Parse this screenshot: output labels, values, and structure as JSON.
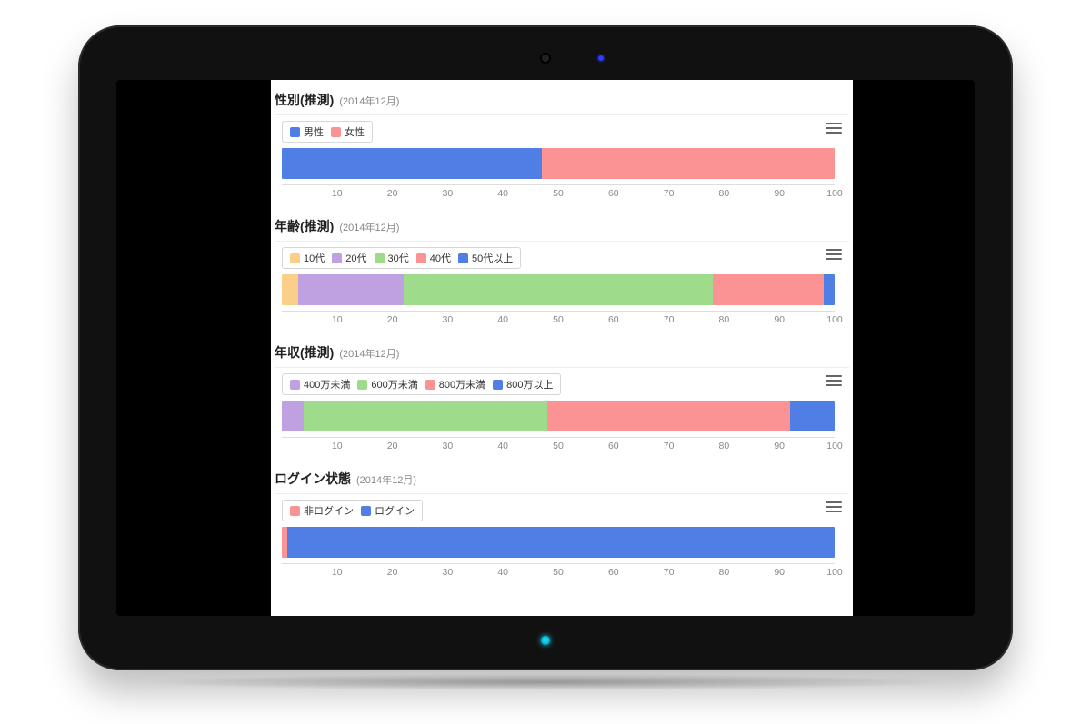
{
  "date_label": "(2014年12月)",
  "axis_ticks": [
    10,
    20,
    30,
    40,
    50,
    60,
    70,
    80,
    90,
    100
  ],
  "colors": {
    "blue": "#4f7ee5",
    "pink": "#fb9394",
    "orange": "#fbce8a",
    "purple": "#bfa0e0",
    "green": "#9edc8b"
  },
  "charts": [
    {
      "id": "gender",
      "title": "性別(推測)",
      "series": [
        {
          "name": "男性",
          "color": "blue",
          "value": 47
        },
        {
          "name": "女性",
          "color": "pink",
          "value": 53
        }
      ]
    },
    {
      "id": "age",
      "title": "年齢(推測)",
      "series": [
        {
          "name": "10代",
          "color": "orange",
          "value": 3
        },
        {
          "name": "20代",
          "color": "purple",
          "value": 19
        },
        {
          "name": "30代",
          "color": "green",
          "value": 56
        },
        {
          "name": "40代",
          "color": "pink",
          "value": 20
        },
        {
          "name": "50代以上",
          "color": "blue",
          "value": 2
        }
      ]
    },
    {
      "id": "income",
      "title": "年収(推測)",
      "series": [
        {
          "name": "400万未満",
          "color": "purple",
          "value": 4
        },
        {
          "name": "600万未満",
          "color": "green",
          "value": 44
        },
        {
          "name": "800万未満",
          "color": "pink",
          "value": 44
        },
        {
          "name": "800万以上",
          "color": "blue",
          "value": 8
        }
      ]
    },
    {
      "id": "login",
      "title": "ログイン状態",
      "series": [
        {
          "name": "非ログイン",
          "color": "pink",
          "value": 1
        },
        {
          "name": "ログイン",
          "color": "blue",
          "value": 99
        }
      ]
    }
  ],
  "chart_data": [
    {
      "type": "bar",
      "title": "性別(推測) (2014年12月)",
      "orientation": "horizontal-stacked-100",
      "xlabel": "",
      "ylabel": "",
      "xlim": [
        0,
        100
      ],
      "categories": [
        ""
      ],
      "series": [
        {
          "name": "男性",
          "values": [
            47
          ]
        },
        {
          "name": "女性",
          "values": [
            53
          ]
        }
      ],
      "x_ticks": [
        10,
        20,
        30,
        40,
        50,
        60,
        70,
        80,
        90,
        100
      ]
    },
    {
      "type": "bar",
      "title": "年齢(推測) (2014年12月)",
      "orientation": "horizontal-stacked-100",
      "xlabel": "",
      "ylabel": "",
      "xlim": [
        0,
        100
      ],
      "categories": [
        ""
      ],
      "series": [
        {
          "name": "10代",
          "values": [
            3
          ]
        },
        {
          "name": "20代",
          "values": [
            19
          ]
        },
        {
          "name": "30代",
          "values": [
            56
          ]
        },
        {
          "name": "40代",
          "values": [
            20
          ]
        },
        {
          "name": "50代以上",
          "values": [
            2
          ]
        }
      ],
      "x_ticks": [
        10,
        20,
        30,
        40,
        50,
        60,
        70,
        80,
        90,
        100
      ]
    },
    {
      "type": "bar",
      "title": "年収(推測) (2014年12月)",
      "orientation": "horizontal-stacked-100",
      "xlabel": "",
      "ylabel": "",
      "xlim": [
        0,
        100
      ],
      "categories": [
        ""
      ],
      "series": [
        {
          "name": "400万未満",
          "values": [
            4
          ]
        },
        {
          "name": "600万未満",
          "values": [
            44
          ]
        },
        {
          "name": "800万未満",
          "values": [
            44
          ]
        },
        {
          "name": "800万以上",
          "values": [
            8
          ]
        }
      ],
      "x_ticks": [
        10,
        20,
        30,
        40,
        50,
        60,
        70,
        80,
        90,
        100
      ]
    },
    {
      "type": "bar",
      "title": "ログイン状態 (2014年12月)",
      "orientation": "horizontal-stacked-100",
      "xlabel": "",
      "ylabel": "",
      "xlim": [
        0,
        100
      ],
      "categories": [
        ""
      ],
      "series": [
        {
          "name": "非ログイン",
          "values": [
            1
          ]
        },
        {
          "name": "ログイン",
          "values": [
            99
          ]
        }
      ],
      "x_ticks": [
        10,
        20,
        30,
        40,
        50,
        60,
        70,
        80,
        90,
        100
      ]
    }
  ]
}
